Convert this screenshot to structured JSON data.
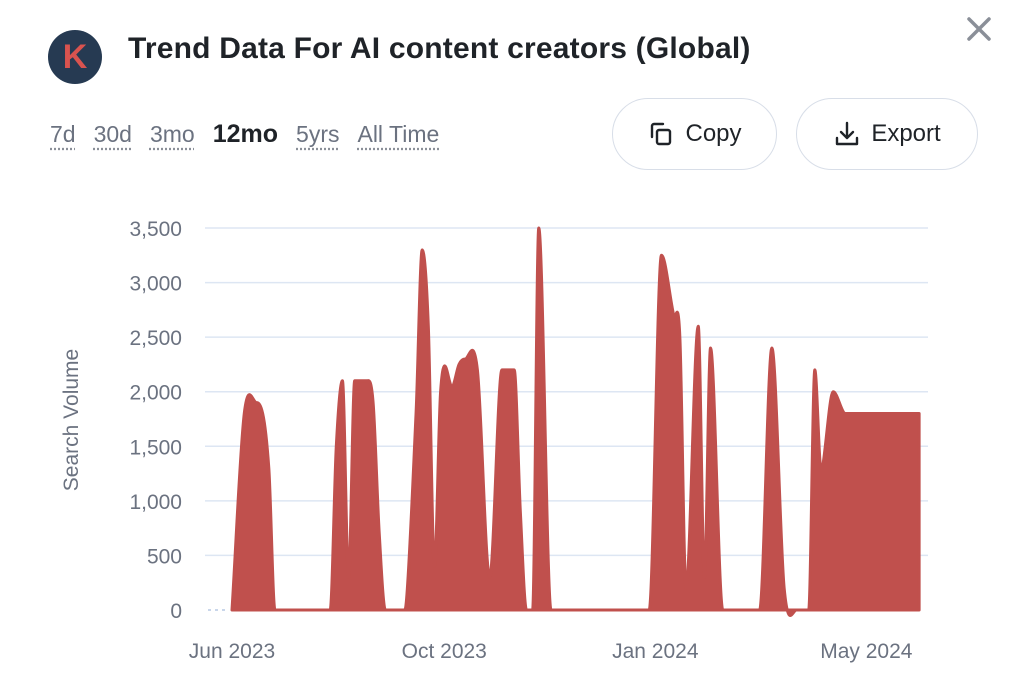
{
  "header": {
    "logo_letter": "K",
    "title": "Trend Data For AI content creators (Global)",
    "close_icon": "close-icon"
  },
  "ranges": [
    {
      "label": "7d",
      "active": false
    },
    {
      "label": "30d",
      "active": false
    },
    {
      "label": "3mo",
      "active": false
    },
    {
      "label": "12mo",
      "active": true
    },
    {
      "label": "5yrs",
      "active": false
    },
    {
      "label": "All Time",
      "active": false
    }
  ],
  "actions": {
    "copy_label": "Copy",
    "copy_icon": "copy-icon",
    "export_label": "Export",
    "export_icon": "download-icon"
  },
  "colors": {
    "series": "#c0504d",
    "grid": "#dde6f3",
    "logo_bg": "#263a52",
    "logo_letter": "#d9534f"
  },
  "chart_data": {
    "type": "area",
    "title": "Trend Data For AI content creators (Global)",
    "xlabel": "",
    "ylabel": "Search Volume",
    "ylim": [
      0,
      3500
    ],
    "yticks": [
      0,
      500,
      1000,
      1500,
      2000,
      2500,
      3000,
      3500
    ],
    "ytick_labels": [
      "0",
      "500",
      "1,000",
      "1,500",
      "2,000",
      "2,500",
      "3,000",
      "3,500"
    ],
    "xticks": [
      {
        "label": "Jun 2023",
        "week": 0
      },
      {
        "label": "Oct 2023",
        "week": 17.3
      },
      {
        "label": "Jan 2024",
        "week": 34.5
      },
      {
        "label": "May 2024",
        "week": 51.7
      }
    ],
    "grid": true,
    "legend": "none",
    "series": [
      {
        "name": "Search Volume",
        "x_weeks": [
          0,
          1,
          2,
          3,
          3.5,
          4,
          5,
          6,
          7,
          8,
          8.5,
          9,
          9.5,
          10,
          11,
          11.5,
          12,
          12.5,
          13,
          14,
          15,
          15.5,
          16,
          16.5,
          17,
          18,
          18.5,
          19,
          20,
          21,
          22,
          23,
          23.5,
          24,
          24.5,
          25,
          26,
          26.5,
          27,
          28,
          28.5,
          29,
          29.5,
          30,
          31,
          32,
          33,
          34,
          35,
          36,
          36.5,
          37,
          38,
          38.5,
          39,
          40,
          40.5,
          41,
          42,
          42.5,
          43,
          44,
          45,
          46,
          47,
          47.5,
          48,
          49,
          50,
          51,
          51.5,
          52,
          52.5,
          53,
          54,
          55,
          55.5,
          56
        ],
        "values": [
          0,
          1800,
          1900,
          1300,
          0,
          0,
          0,
          0,
          0,
          0,
          1500,
          2100,
          300,
          2100,
          2100,
          1900,
          700,
          0,
          0,
          0,
          1800,
          3300,
          2600,
          400,
          2000,
          2050,
          2250,
          2300,
          2200,
          300,
          2200,
          2200,
          900,
          0,
          0,
          3500,
          0,
          0,
          0,
          0,
          0,
          0,
          0,
          0,
          0,
          0,
          0,
          0,
          3250,
          2700,
          2500,
          200,
          2600,
          300,
          2400,
          0,
          0,
          0,
          0,
          0,
          0,
          2400,
          200,
          0,
          0,
          2200,
          1300,
          2000,
          1800,
          1800,
          1800,
          1800,
          1800,
          1800,
          1800,
          1800,
          1800,
          1800
        ]
      }
    ]
  }
}
